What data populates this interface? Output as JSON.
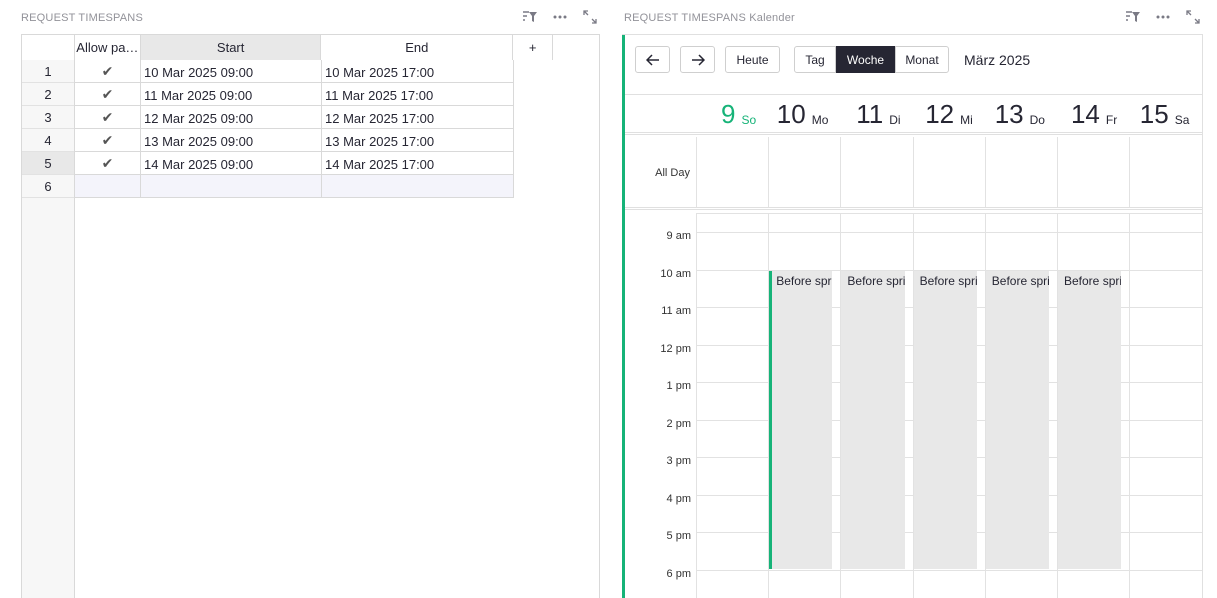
{
  "left_widget": {
    "title": "REQUEST TIMESPANS",
    "icons": [
      "sort-filter-icon",
      "more-icon",
      "expand-icon"
    ]
  },
  "table": {
    "columns": [
      "Allow pa…",
      "Start",
      "End",
      "+"
    ],
    "rows": [
      {
        "num": "1",
        "allow": "✔",
        "start": "10 Mar 2025 09:00",
        "end": "10 Mar 2025 17:00"
      },
      {
        "num": "2",
        "allow": "✔",
        "start": "11 Mar 2025 09:00",
        "end": "11 Mar 2025 17:00"
      },
      {
        "num": "3",
        "allow": "✔",
        "start": "12 Mar 2025 09:00",
        "end": "12 Mar 2025 17:00"
      },
      {
        "num": "4",
        "allow": "✔",
        "start": "13 Mar 2025 09:00",
        "end": "13 Mar 2025 17:00"
      },
      {
        "num": "5",
        "allow": "✔",
        "start": "14 Mar 2025 09:00",
        "end": "14 Mar 2025 17:00"
      }
    ],
    "new_row_num": "6"
  },
  "right_widget": {
    "title": "REQUEST TIMESPANS Kalender",
    "icons": [
      "sort-filter-icon",
      "more-icon",
      "expand-icon"
    ]
  },
  "calendar": {
    "today_label": "Heute",
    "views": [
      "Tag",
      "Woche",
      "Monat"
    ],
    "active_view": "Woche",
    "title": "März 2025",
    "days": [
      {
        "num": "9",
        "name": "So",
        "today": true
      },
      {
        "num": "10",
        "name": "Mo"
      },
      {
        "num": "11",
        "name": "Di"
      },
      {
        "num": "12",
        "name": "Mi"
      },
      {
        "num": "13",
        "name": "Do"
      },
      {
        "num": "14",
        "name": "Fr"
      },
      {
        "num": "15",
        "name": "Sa"
      }
    ],
    "all_day_label": "All Day",
    "hours": [
      "9 am",
      "10 am",
      "11 am",
      "12 pm",
      "1 pm",
      "2 pm",
      "3 pm",
      "4 pm",
      "5 pm",
      "6 pm"
    ],
    "events": [
      {
        "day": 1,
        "label": "Before spri"
      },
      {
        "day": 2,
        "label": "Before spri"
      },
      {
        "day": 3,
        "label": "Before spri"
      },
      {
        "day": 4,
        "label": "Before spri"
      },
      {
        "day": 5,
        "label": "Before spri"
      }
    ],
    "colors": {
      "accent": "#16b378",
      "event_bg": "#e8e8e8",
      "active_btn": "#262633"
    }
  }
}
